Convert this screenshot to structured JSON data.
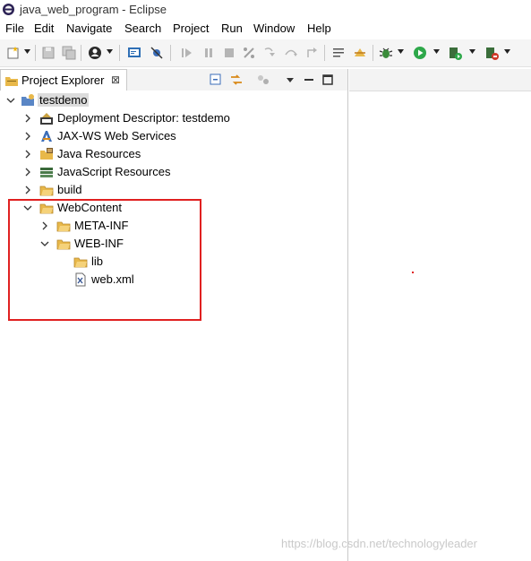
{
  "window": {
    "title": "java_web_program - Eclipse"
  },
  "menu": [
    "File",
    "Edit",
    "Navigate",
    "Search",
    "Project",
    "Run",
    "Window",
    "Help"
  ],
  "view": {
    "tab_label": "Project Explorer",
    "tab_close": "⊠"
  },
  "tree": [
    {
      "label": "testdemo"
    },
    {
      "label": "Deployment Descriptor: testdemo"
    },
    {
      "label": "JAX-WS Web Services"
    },
    {
      "label": "Java Resources"
    },
    {
      "label": "JavaScript Resources"
    },
    {
      "label": "build"
    },
    {
      "label": "WebContent"
    },
    {
      "label": "META-INF"
    },
    {
      "label": "WEB-INF"
    },
    {
      "label": "lib"
    },
    {
      "label": "web.xml"
    }
  ],
  "icons": {
    "project": "project-icon",
    "descriptor": "deployment-descriptor-icon",
    "webservices": "web-services-icon",
    "java": "java-resources-icon",
    "javascript": "javascript-resources-icon",
    "folder": "folder-icon",
    "xml": "xml-file-icon"
  },
  "colors": {
    "highlight": "#e02020",
    "folder": "#e8b84a",
    "run_green": "#2ea84a"
  },
  "watermark": "https://blog.csdn.net/technologyleader"
}
